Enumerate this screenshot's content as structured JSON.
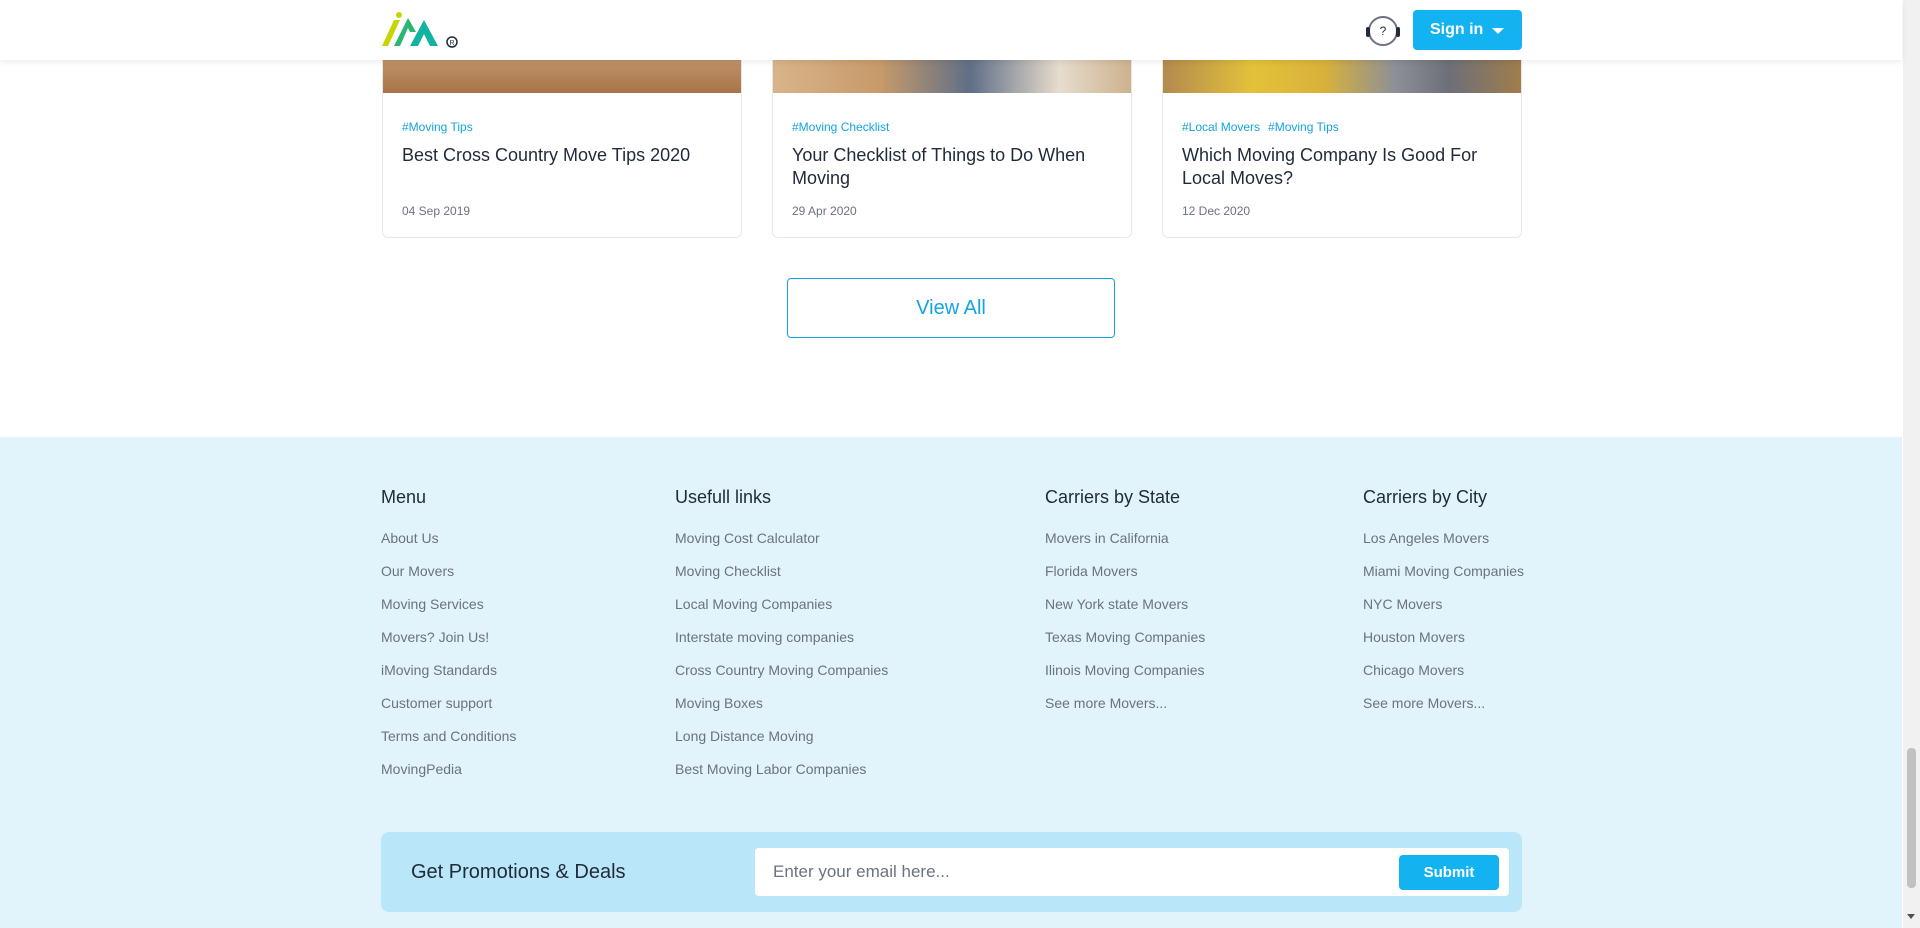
{
  "header": {
    "signin_label": "Sign in",
    "help_glyph": "?",
    "logo_icon": "imoving-logo-icon",
    "accent_color": "#12b3f0"
  },
  "blog": {
    "cards": [
      {
        "tags": [
          "#Moving Tips"
        ],
        "title": "Best Cross Country Move Tips 2020",
        "date": "04 Sep 2019"
      },
      {
        "tags": [
          "#Moving Checklist"
        ],
        "title": "Your Checklist of Things to Do When Moving",
        "date": "29 Apr 2020"
      },
      {
        "tags": [
          "#Local Movers",
          "#Moving Tips"
        ],
        "title": "Which Moving Company Is Good For Local Moves?",
        "date": "12 Dec 2020"
      }
    ],
    "view_all_label": "View All"
  },
  "footer": {
    "menu": {
      "title": "Menu",
      "links": [
        "About Us",
        "Our Movers",
        "Moving Services",
        "Movers? Join Us!",
        "iMoving Standards",
        "Customer support",
        "Terms and Conditions",
        "MovingPedia"
      ]
    },
    "useful": {
      "title": "Usefull links",
      "links": [
        "Moving Cost Calculator",
        "Moving Checklist",
        "Local Moving Companies",
        "Interstate moving companies",
        "Cross Country Moving Companies",
        "Moving Boxes",
        "Long Distance Moving",
        "Best Moving Labor Companies"
      ]
    },
    "state": {
      "title": "Carriers by State",
      "links": [
        "Movers in California",
        "Florida Movers",
        "New York state Movers",
        "Texas Moving Companies",
        "Ilinois Moving Companies",
        "See more Movers..."
      ]
    },
    "city": {
      "title": "Carriers by City",
      "links": [
        "Los Angeles Movers",
        "Miami Moving Companies",
        "NYC Movers",
        "Houston Movers",
        "Chicago Movers",
        "See more Movers..."
      ]
    },
    "promo": {
      "title": "Get Promotions & Deals",
      "email_placeholder": "Enter your email here...",
      "email_value": "",
      "submit_label": "Submit"
    }
  }
}
